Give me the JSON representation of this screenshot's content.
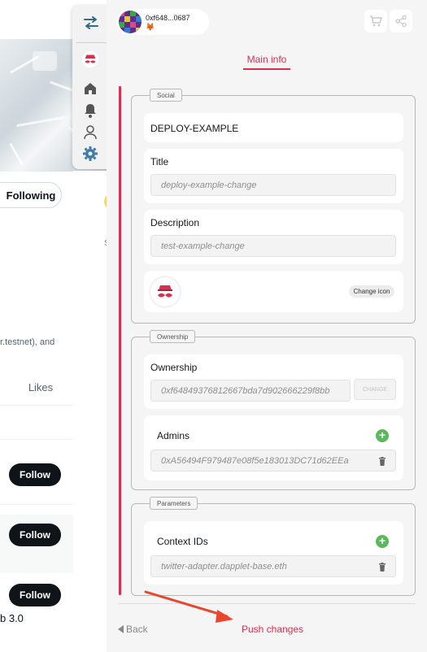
{
  "background": {
    "following_label": "Following",
    "testnet_text": "r.testnet), and",
    "likes_tab": "Likes",
    "follow_labels": [
      "Follow",
      "Follow",
      "Follow"
    ],
    "bottom_text": "b 3.0",
    "mid_link": "S"
  },
  "header": {
    "wallet_address": "0xf648...0687",
    "wallet_icon": "🦊"
  },
  "tabs": {
    "main_info": "Main info"
  },
  "social": {
    "legend": "Social",
    "name": "DEPLOY-EXAMPLE",
    "title_label": "Title",
    "title_value": "deploy-example-change",
    "description_label": "Description",
    "description_value": "test-example-change",
    "change_icon_label": "Change icon"
  },
  "ownership": {
    "legend": "Ownership",
    "label": "Ownership",
    "owner_value": "0xf64849376812667bda7d902666229f8bb",
    "change_label": "CHANGE",
    "admins_label": "Admins",
    "admin_value": "0xA56494F979487e08f5e183013DC71d62EEa"
  },
  "parameters": {
    "legend": "Parameters",
    "context_label": "Context IDs",
    "context_value": "twitter-adapter.dapplet-base.eth"
  },
  "footer": {
    "back_label": "Back",
    "push_label": "Push changes"
  },
  "colors": {
    "accent": "#d9304f",
    "add_green": "#5cb85c"
  }
}
